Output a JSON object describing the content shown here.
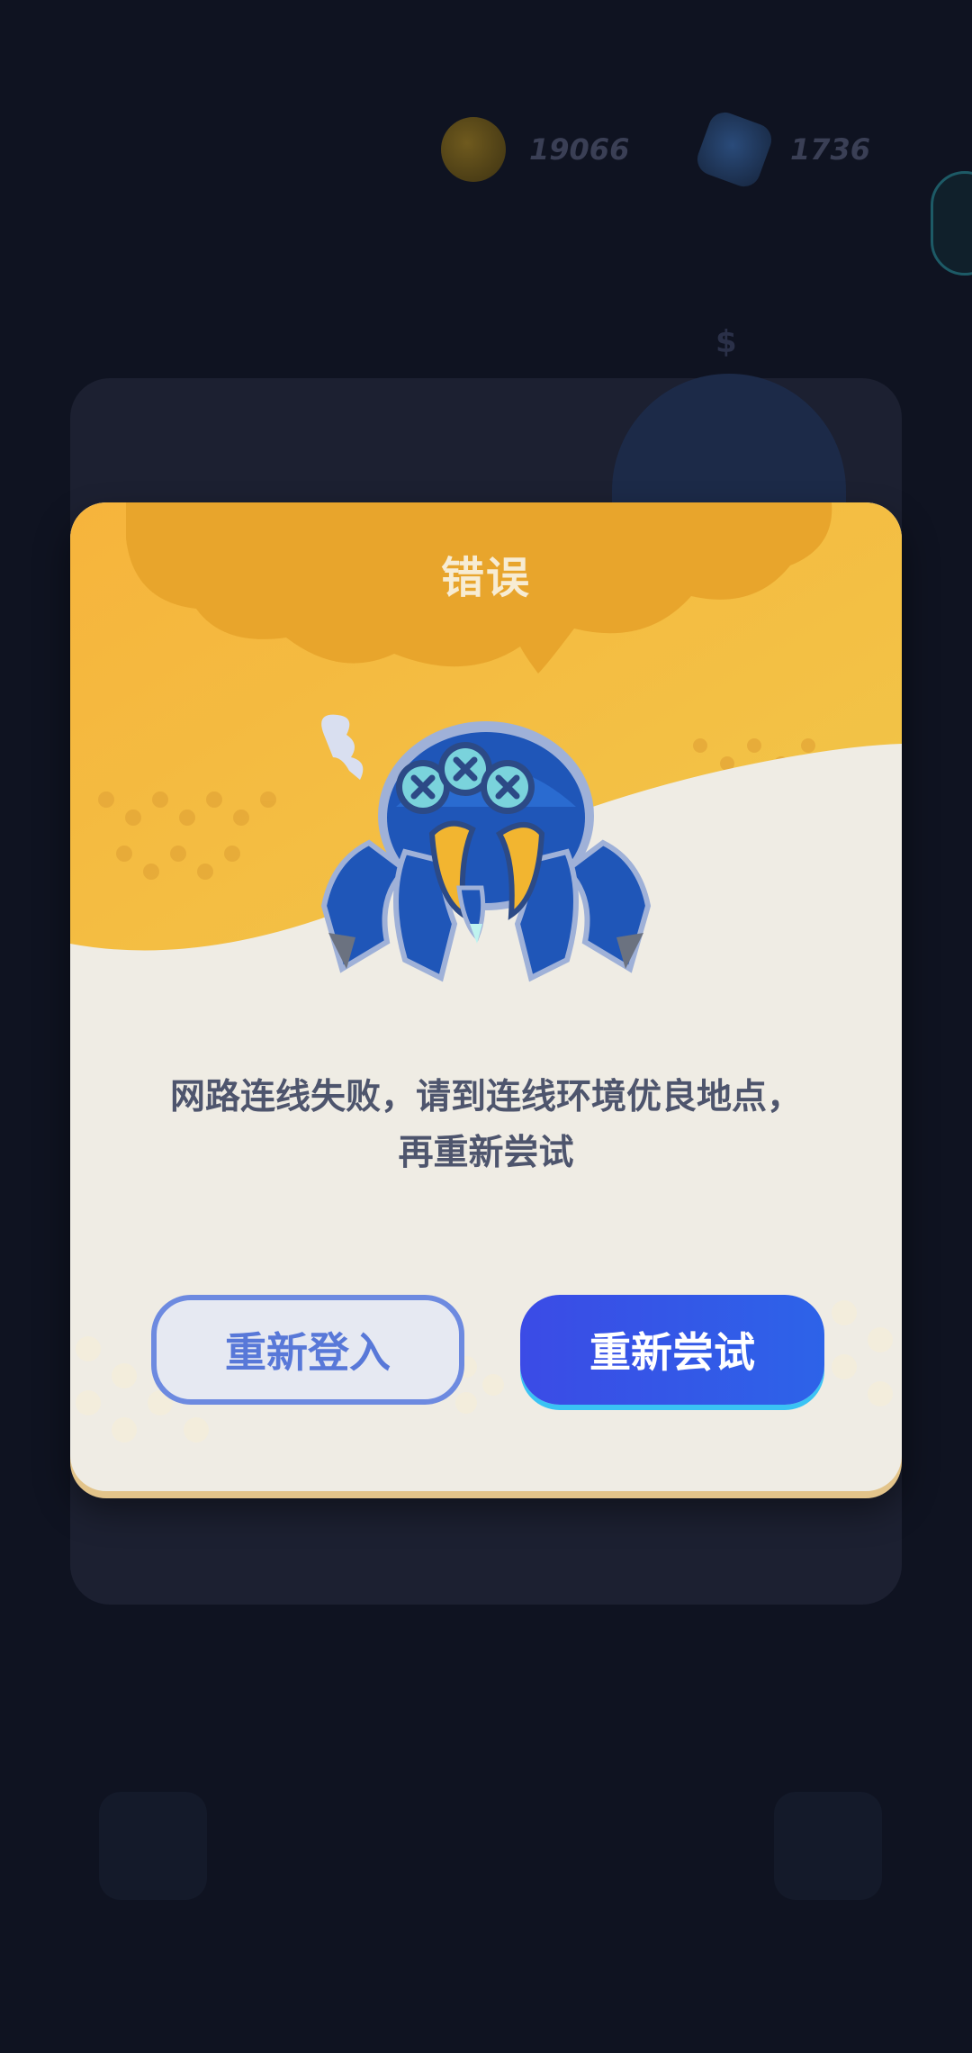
{
  "currency": {
    "coins": "19066",
    "gems": "1736"
  },
  "dialog": {
    "title": "错误",
    "message": "网路连线失败，请到连线环境优良地点，\n再重新尝试",
    "relogin_label": "重新登入",
    "retry_label": "重新尝试"
  },
  "icons": {
    "coin": "coin-icon",
    "gem": "gem-icon",
    "mascot": "spider-robot-mascot"
  },
  "colors": {
    "background": "#0f1321",
    "modal_orange": "#f2b736",
    "modal_cream": "#efece4",
    "primary_button": "#3b4be6",
    "secondary_button_border": "#6d8ae0"
  }
}
